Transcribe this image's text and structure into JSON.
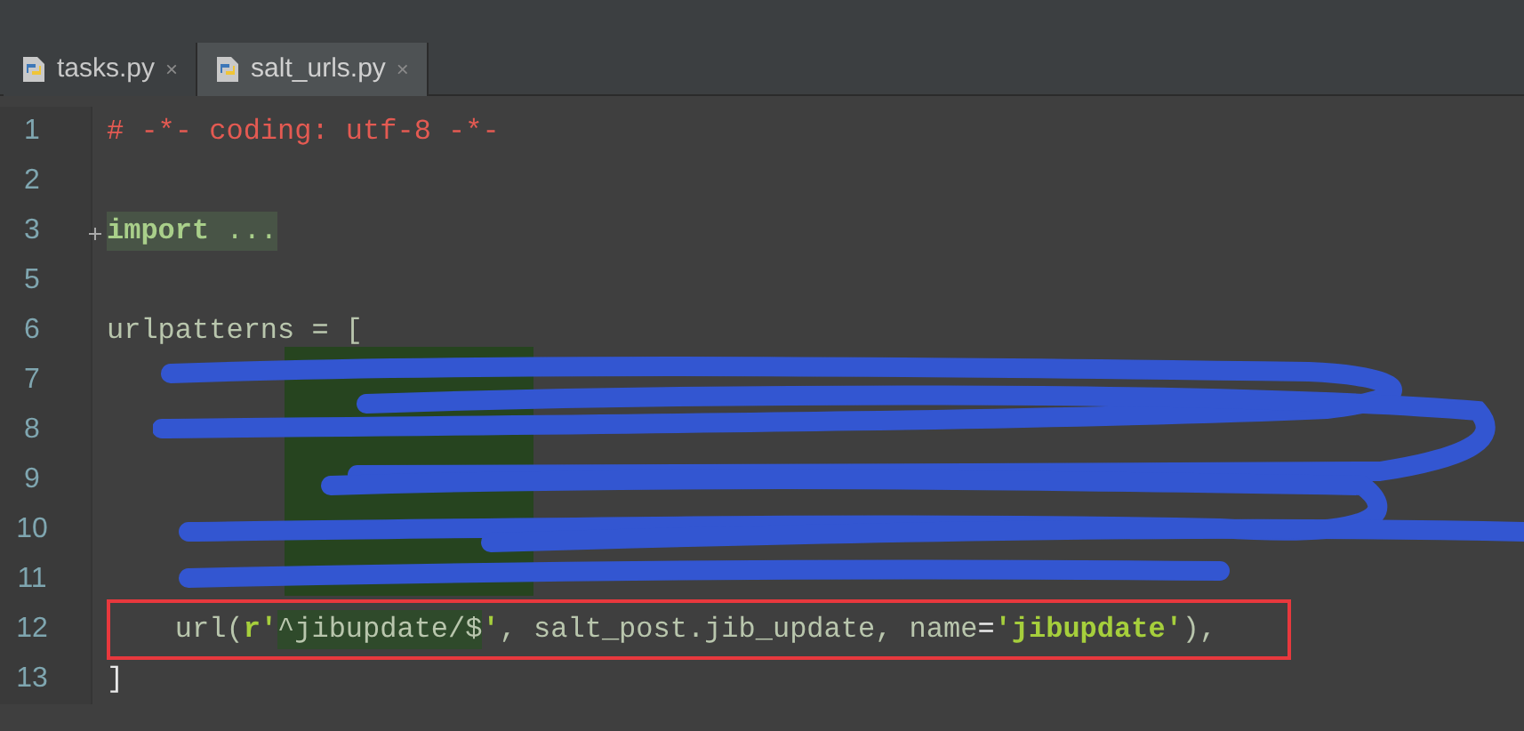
{
  "tabs": [
    {
      "label": "tasks.py",
      "close": "×",
      "selected": false
    },
    {
      "label": "salt_urls.py",
      "close": "×",
      "selected": true
    }
  ],
  "lines": [
    {
      "number": "1",
      "tokens": [
        {
          "kind": "comment",
          "text": "# -*- coding: utf-8 -*-"
        }
      ]
    },
    {
      "number": "2"
    },
    {
      "number": "3",
      "folded": true,
      "tokens": [
        {
          "kind": "keyword",
          "text": "import"
        },
        {
          "kind": "folded",
          "text": " ..."
        }
      ]
    },
    {
      "number": "5"
    },
    {
      "number": "6",
      "tokens": [
        {
          "kind": "plain",
          "text": "urlpatterns = ["
        }
      ]
    },
    {
      "number": "7"
    },
    {
      "number": "8"
    },
    {
      "number": "9"
    },
    {
      "number": "10"
    },
    {
      "number": "11"
    },
    {
      "number": "12",
      "highlighted": true,
      "tokens": [
        {
          "kind": "plain",
          "text": "    url("
        },
        {
          "kind": "string",
          "text": "r'"
        },
        {
          "kind": "regex",
          "text": "^jibupdate/$"
        },
        {
          "kind": "string",
          "text": "'"
        },
        {
          "kind": "plain",
          "text": ", salt_post.jib_update, name"
        },
        {
          "kind": "operator",
          "text": "="
        },
        {
          "kind": "string",
          "text": "'jibupdate'"
        },
        {
          "kind": "plain",
          "text": "),"
        }
      ]
    },
    {
      "number": "13",
      "tokens": [
        {
          "kind": "operator",
          "text": "]"
        }
      ]
    }
  ]
}
